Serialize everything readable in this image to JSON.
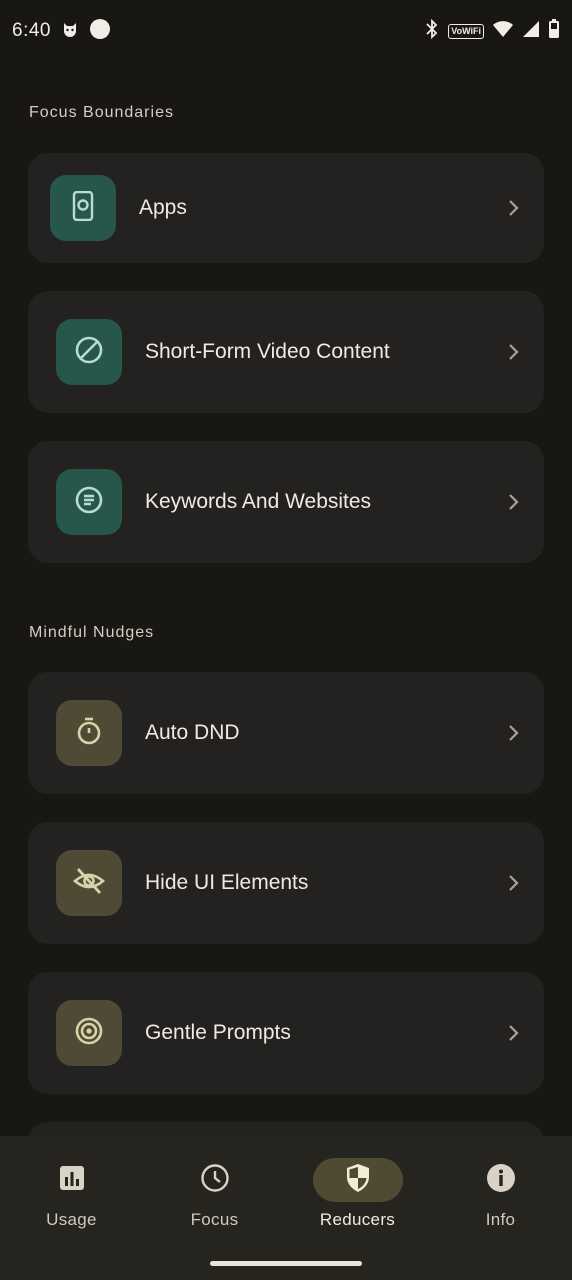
{
  "status_bar": {
    "time": "6:40",
    "vowifi": "VoWiFi",
    "icons": [
      "cat-icon",
      "circle-icon",
      "bluetooth-icon",
      "vowifi-icon",
      "wifi-icon",
      "signal-icon",
      "battery-icon"
    ]
  },
  "sections": {
    "focus_boundaries": {
      "title": "Focus Boundaries",
      "items": [
        {
          "label": "Apps",
          "icon": "phone-icon",
          "color": "#26574a"
        },
        {
          "label": "Short-Form Video Content",
          "icon": "block-icon",
          "color": "#26574a"
        },
        {
          "label": "Keywords And Websites",
          "icon": "text-icon",
          "color": "#26574a"
        }
      ]
    },
    "mindful_nudges": {
      "title": "Mindful Nudges",
      "items": [
        {
          "label": "Auto DND",
          "icon": "timer-icon",
          "color": "#4e4a35"
        },
        {
          "label": "Hide UI Elements",
          "icon": "eye-off-icon",
          "color": "#4e4a35"
        },
        {
          "label": "Gentle Prompts",
          "icon": "target-icon",
          "color": "#4e4a35"
        }
      ]
    }
  },
  "nav": {
    "items": [
      {
        "label": "Usage",
        "icon": "bar-chart-icon"
      },
      {
        "label": "Focus",
        "icon": "clock-icon"
      },
      {
        "label": "Reducers",
        "icon": "shield-icon",
        "active": true
      },
      {
        "label": "Info",
        "icon": "info-icon"
      }
    ]
  },
  "colors": {
    "background": "#181713",
    "card": "#232220",
    "green_tile": "#26574a",
    "olive_tile": "#4e4a35",
    "nav_active": "#4f4b33"
  }
}
